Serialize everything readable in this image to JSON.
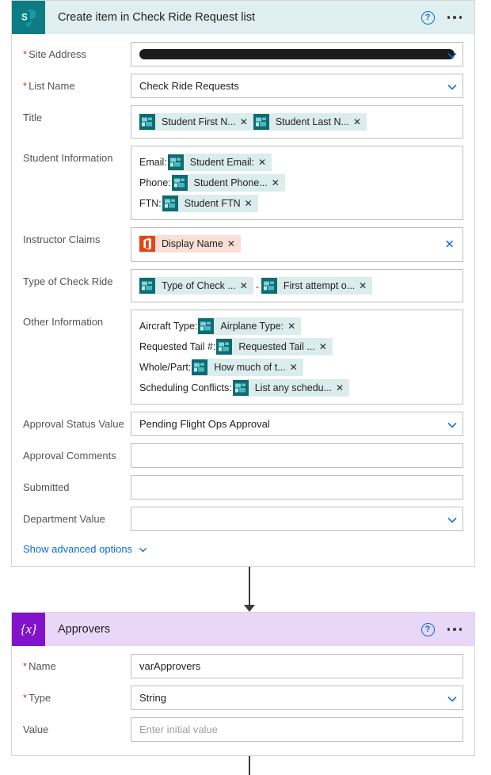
{
  "sharepoint_card": {
    "title": "Create item in Check Ride Request list",
    "icon": "sharepoint-icon",
    "help_icon": "help-icon",
    "more_icon": "more-options-icon",
    "advanced_link": "Show advanced options",
    "fields": [
      {
        "label": "Site Address",
        "required": true,
        "type": "dropdown-redacted",
        "value": "",
        "redacted": true
      },
      {
        "label": "List Name",
        "required": true,
        "type": "dropdown",
        "value": "Check Ride Requests"
      },
      {
        "label": "Title",
        "required": false,
        "type": "tokens",
        "lines": [
          {
            "prefix": "",
            "chips": [
              {
                "text": "Student First N...",
                "icon": "sharepoint-list-icon",
                "kind": "sp"
              },
              {
                "text": "Student Last N...",
                "icon": "sharepoint-list-icon",
                "kind": "sp"
              }
            ]
          }
        ]
      },
      {
        "label": "Student Information",
        "required": false,
        "type": "tokens",
        "lines": [
          {
            "prefix": "Email:",
            "chips": [
              {
                "text": "Student Email:",
                "icon": "sharepoint-list-icon",
                "kind": "sp"
              }
            ]
          },
          {
            "prefix": "Phone:",
            "chips": [
              {
                "text": "Student Phone...",
                "icon": "sharepoint-list-icon",
                "kind": "sp"
              }
            ]
          },
          {
            "prefix": "FTN:",
            "chips": [
              {
                "text": "Student FTN",
                "icon": "sharepoint-list-icon",
                "kind": "sp"
              }
            ]
          }
        ]
      },
      {
        "label": "Instructor Claims",
        "required": false,
        "type": "tokens-clearable",
        "clear_icon": "close-icon",
        "lines": [
          {
            "prefix": "",
            "chips": [
              {
                "text": "Display Name",
                "icon": "office365-icon",
                "kind": "o365"
              }
            ]
          }
        ]
      },
      {
        "label": "Type of Check Ride",
        "required": false,
        "type": "tokens",
        "lines": [
          {
            "prefix": "",
            "chips": [
              {
                "text": "Type of Check ...",
                "icon": "sharepoint-list-icon",
                "kind": "sp"
              },
              {
                "separator": "-"
              },
              {
                "text": "First attempt o...",
                "icon": "sharepoint-list-icon",
                "kind": "sp"
              }
            ]
          }
        ]
      },
      {
        "label": "Other Information",
        "required": false,
        "type": "tokens",
        "lines": [
          {
            "prefix": "Aircraft Type:",
            "chips": [
              {
                "text": "Airplane Type:",
                "icon": "sharepoint-list-icon",
                "kind": "sp"
              }
            ]
          },
          {
            "prefix": "Requested Tail #:",
            "chips": [
              {
                "text": "Requested Tail ...",
                "icon": "sharepoint-list-icon",
                "kind": "sp"
              }
            ]
          },
          {
            "prefix": "Whole/Part:",
            "chips": [
              {
                "text": "How much of t...",
                "icon": "sharepoint-list-icon",
                "kind": "sp"
              }
            ]
          },
          {
            "prefix": "Scheduling Conflicts:",
            "chips": [
              {
                "text": "List any schedu...",
                "icon": "sharepoint-list-icon",
                "kind": "sp"
              }
            ]
          }
        ]
      },
      {
        "label": "Approval Status Value",
        "required": false,
        "type": "dropdown",
        "value": "Pending Flight Ops Approval"
      },
      {
        "label": "Approval Comments",
        "required": false,
        "type": "text",
        "value": ""
      },
      {
        "label": "Submitted",
        "required": false,
        "type": "text",
        "value": ""
      },
      {
        "label": "Department Value",
        "required": false,
        "type": "dropdown",
        "value": ""
      }
    ]
  },
  "variable_card": {
    "title": "Approvers",
    "icon": "variable-icon",
    "icon_glyph": "{x}",
    "help_icon": "help-icon",
    "more_icon": "more-options-icon",
    "fields": [
      {
        "label": "Name",
        "required": true,
        "type": "text",
        "value": "varApprovers"
      },
      {
        "label": "Type",
        "required": true,
        "type": "dropdown",
        "value": "String"
      },
      {
        "label": "Value",
        "required": false,
        "type": "text",
        "value": "",
        "placeholder": "Enter initial value"
      }
    ]
  },
  "colors": {
    "sharepoint_teal": "#0f7c84",
    "sharepoint_header": "#dfeeee",
    "variable_purple": "#8312cb",
    "variable_header": "#e9d7f7",
    "chip_teal_bg": "#dbecec",
    "chip_office_bg": "#fadfd8",
    "link_blue": "#0b6cda",
    "required_red": "#d0342c"
  }
}
